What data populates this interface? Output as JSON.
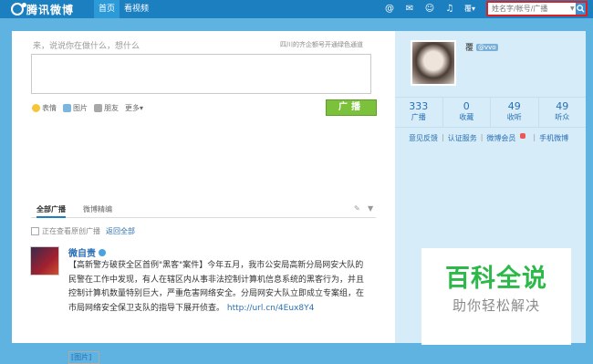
{
  "topbar": {
    "logo": "腾讯微博",
    "nav": [
      "首页",
      "看视频"
    ],
    "icons": [
      "at-icon",
      "mail-icon",
      "user-icon",
      "bell-icon",
      "settings-icon"
    ],
    "user_dropdown": "覆",
    "search_placeholder": "姓名字/帐号/广播"
  },
  "compose": {
    "prompt": "来，说说你在做什么，想什么",
    "side_note": "四川的齐企额号开通绿色通道",
    "tools": [
      "表情",
      "图片",
      "朋友",
      "更多"
    ],
    "publish": "广播"
  },
  "feed": {
    "tabs": [
      "全部广播",
      "微博精编"
    ],
    "viewing": "正在查看原创广播",
    "back_all": "返回全部",
    "post": {
      "author": "微自责",
      "lines": [
        "【高新警方破获全区首例\"黑客\"案件】今年五月，我市公安局高新分局网安大队的",
        "民警在工作中发现，有人在辖区内从事非法控制计算机信息系统的黑客行为，并且",
        "控制计算机数量特别巨大，严重危害网络安全。分局网安大队立即成立专案组，在",
        "市局网络安全保卫支队的指导下展开侦查。"
      ],
      "link": "http://url.cn/4Eux8Y4",
      "image_alt": "[图片]"
    }
  },
  "profile": {
    "name": "覆",
    "tag": "@vvo",
    "stats": [
      {
        "n": "333",
        "l": "广播"
      },
      {
        "n": "0",
        "l": "收藏"
      },
      {
        "n": "49",
        "l": "收听"
      },
      {
        "n": "49",
        "l": "听众"
      }
    ],
    "links": [
      "意见反馈",
      "认证服务",
      "微博会员",
      "手机微博"
    ]
  },
  "watermark": {
    "line1": "百科全说",
    "line2": "助你轻松解决"
  }
}
